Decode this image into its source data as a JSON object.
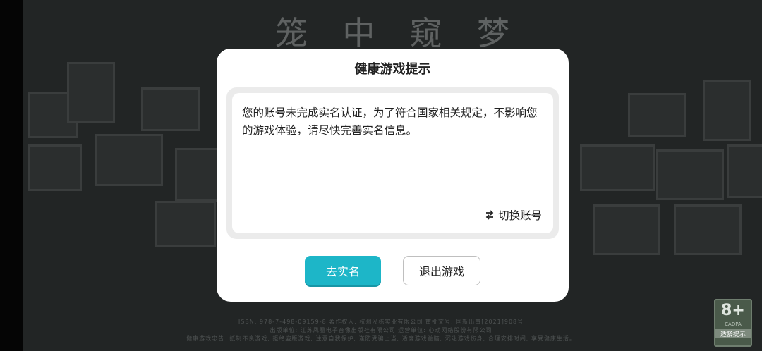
{
  "background": {
    "game_title_chars": [
      "笼",
      "中",
      "窥",
      "梦"
    ],
    "footer_line1": "ISBN: 978-7-498-09159-8        著作权人: 杭州泓栋实业有限公司  审批文号: 国新出审[2021]908号",
    "footer_line2": "出版单位: 江苏凤凰电子音像出版社有限公司     运营单位: 心动网络股份有限公司",
    "footer_line3": "健康游戏忠告: 抵制不良游戏, 拒绝盗版游戏, 注意自我保护, 谨防受骗上当, 适度游戏益脑, 沉迷游戏伤身, 合理安排时间, 享受健康生活。",
    "age_rating": {
      "number": "8+",
      "org": "CADPA",
      "label": "适龄提示"
    }
  },
  "dialog": {
    "title": "健康游戏提示",
    "message": "您的账号未完成实名认证，为了符合国家相关规定，不影响您的游戏体验，请尽快完善实名信息。",
    "switch_account": "切换账号",
    "primary_button": "去实名",
    "secondary_button": "退出游戏"
  },
  "colors": {
    "accent": "#1db6c8",
    "overlay": "#222525"
  }
}
